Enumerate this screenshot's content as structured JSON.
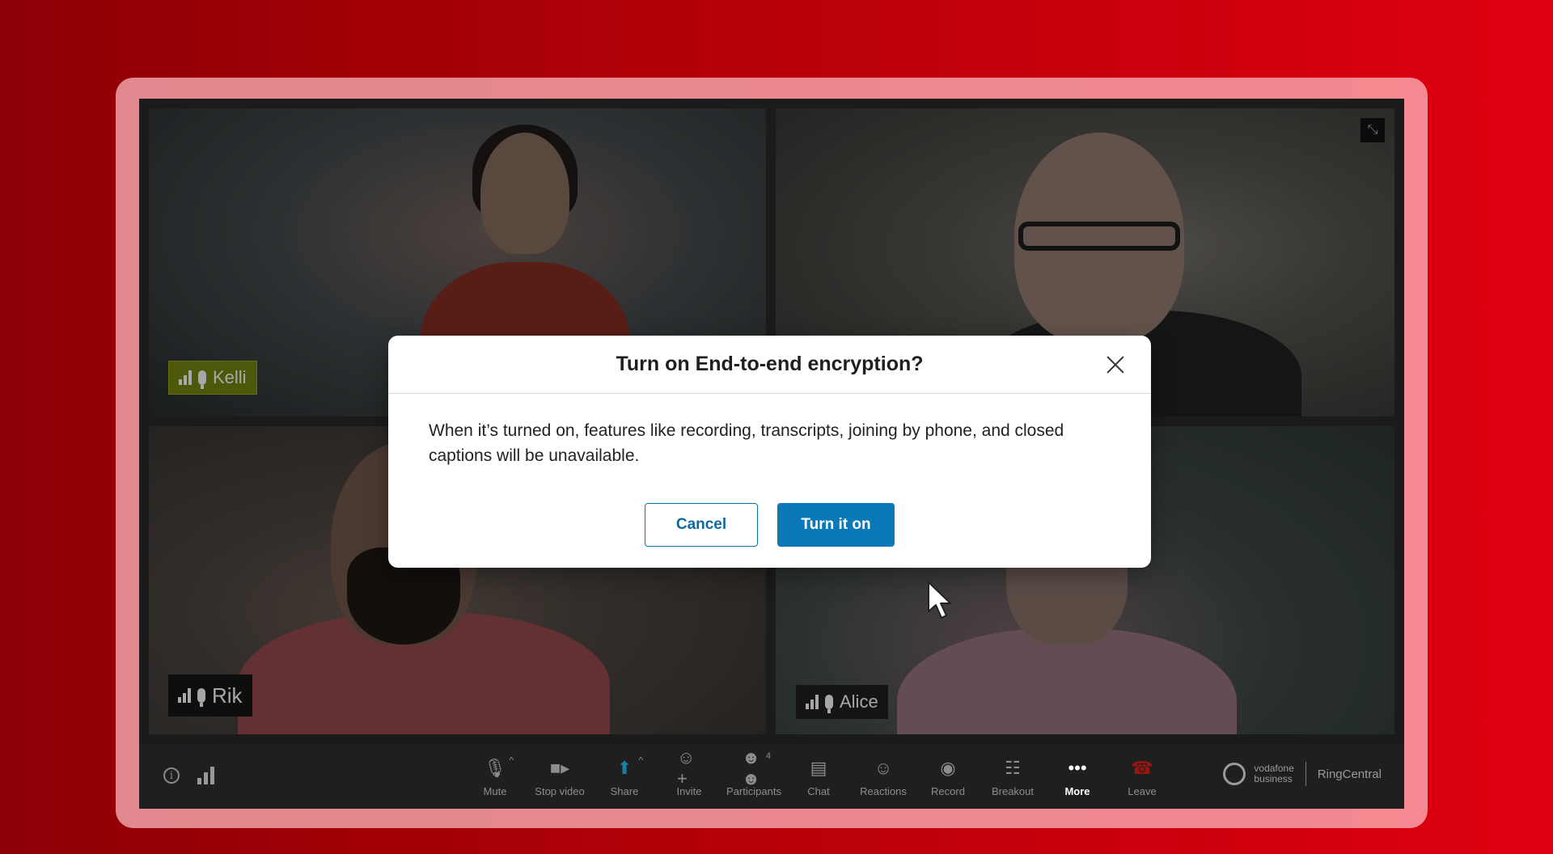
{
  "participants": [
    {
      "name": "Kelli"
    },
    {
      "name": ""
    },
    {
      "name": "Rik"
    },
    {
      "name": "Alice"
    }
  ],
  "toolbar": {
    "buttons": [
      {
        "label": "Mute"
      },
      {
        "label": "Stop video"
      },
      {
        "label": "Share"
      },
      {
        "label": "Invite"
      },
      {
        "label": "Participants",
        "badge": "4"
      },
      {
        "label": "Chat"
      },
      {
        "label": "Reactions"
      },
      {
        "label": "Record"
      },
      {
        "label": "Breakout"
      },
      {
        "label": "More"
      },
      {
        "label": "Leave"
      }
    ]
  },
  "brand": {
    "vodafone_line1": "vodafone",
    "vodafone_line2": "business",
    "ringcentral": "RingCentral"
  },
  "dialog": {
    "title": "Turn on End-to-end encryption?",
    "body": "When it’s turned on, features like recording, transcripts, joining by phone, and closed captions will be unavailable.",
    "cancel_label": "Cancel",
    "confirm_label": "Turn it on"
  },
  "colors": {
    "background_brand": "#e00010",
    "primary": "#0b78b7",
    "leave": "#9b1515",
    "tag_kelli": "#6d7a10"
  }
}
